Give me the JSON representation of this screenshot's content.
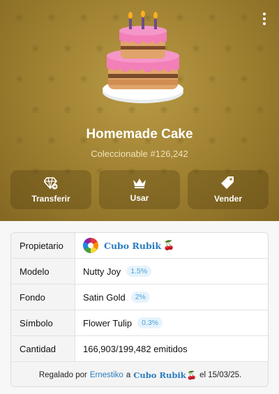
{
  "gift": {
    "title": "Homemade Cake",
    "collectible": "Coleccionable #126,242"
  },
  "actions": [
    {
      "label": "Transferir",
      "icon": "diamond-transfer-icon"
    },
    {
      "label": "Usar",
      "icon": "crown-icon"
    },
    {
      "label": "Vender",
      "icon": "tag-icon"
    }
  ],
  "attributes": {
    "owner_label": "Propietario",
    "owner_name": "Cubo Rubik",
    "owner_emoji": "🍒",
    "model_label": "Modelo",
    "model_value": "Nutty Joy",
    "model_rarity": "1.5%",
    "backdrop_label": "Fondo",
    "backdrop_value": "Satin Gold",
    "backdrop_rarity": "2%",
    "symbol_label": "Símbolo",
    "symbol_value": "Flower Tulip",
    "symbol_rarity": "0.3%",
    "quantity_label": "Cantidad",
    "quantity_value": "166,903/199,482 emitidos"
  },
  "footer": {
    "prefix": "Regalado por",
    "sender": "Ernestiko",
    "middle": "a",
    "recipient": "Cubo Rubik",
    "emoji": "🍒",
    "suffix": "el 15/03/25."
  },
  "colors": {
    "hero_bg": "#9d7f30",
    "link": "#2a7cc0",
    "badge_text": "#4aa3d8"
  }
}
